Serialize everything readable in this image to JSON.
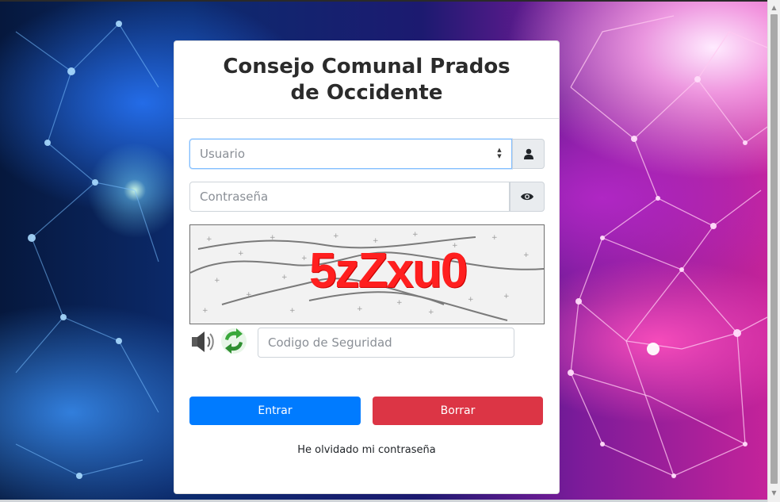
{
  "card": {
    "title": "Consejo Comunal Prados de Occidente"
  },
  "form": {
    "username_placeholder": "Usuario",
    "password_placeholder": "Contraseña",
    "captcha_text": "5zZxu0",
    "security_code_placeholder": "Codigo de Seguridad"
  },
  "buttons": {
    "submit_label": "Entrar",
    "clear_label": "Borrar"
  },
  "links": {
    "forgot_password": "He olvidado mi contraseña"
  },
  "icons": {
    "user": "user-icon",
    "password_toggle": "eye-icon",
    "audio": "speaker-icon",
    "refresh": "refresh-icon"
  },
  "colors": {
    "primary": "#007bff",
    "danger": "#dc3545",
    "captcha_text": "#ff1f1f"
  }
}
